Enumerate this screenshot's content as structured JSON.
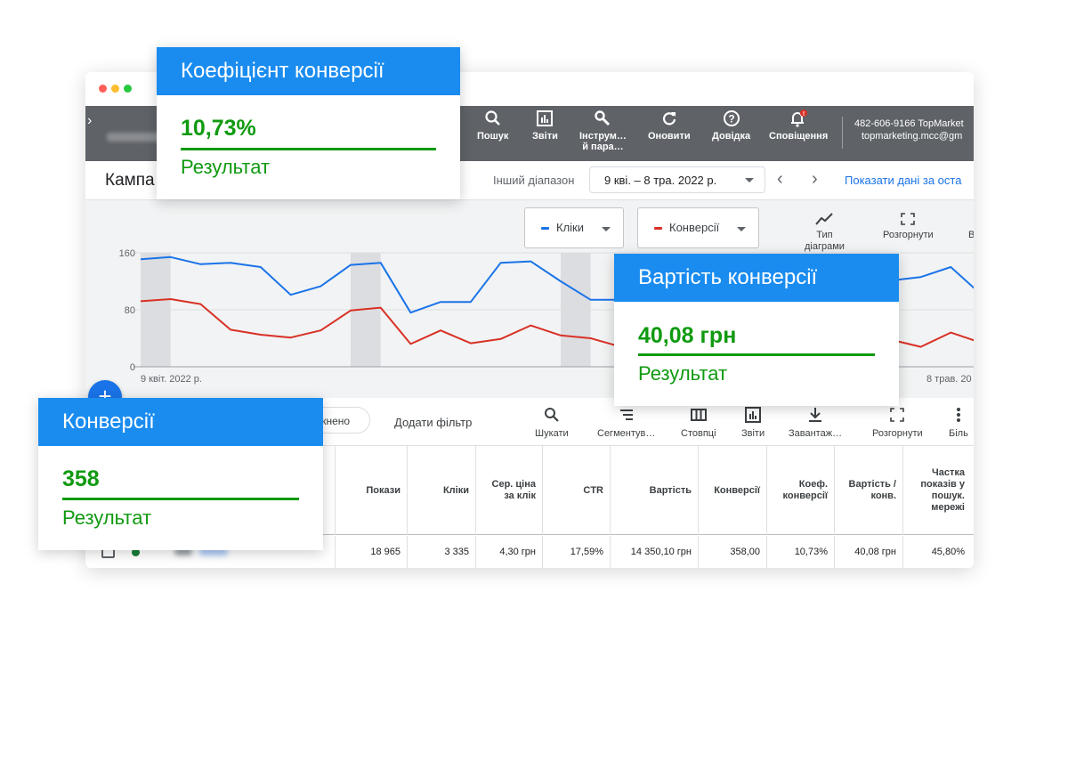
{
  "window": {
    "controls": [
      "close",
      "minimize",
      "maximize"
    ]
  },
  "topbar": {
    "tools": [
      {
        "label": "Пошук",
        "icon": "search-icon"
      },
      {
        "label": "Звіти",
        "icon": "reports-icon"
      },
      {
        "label": "Інструм…",
        "label2": "й пара…",
        "icon": "wrench-icon"
      },
      {
        "label": "Оновити",
        "icon": "refresh-icon"
      },
      {
        "label": "Довідка",
        "icon": "help-icon"
      },
      {
        "label": "Сповіщення",
        "icon": "bell-icon",
        "badge": "!"
      }
    ],
    "account_id": "482-606-9166 TopMarket",
    "account_email": "topmarketing.mcc@gm"
  },
  "subbar": {
    "title": "Кампа",
    "range_label": "Інший діапазон",
    "date_range": "9 кві. – 8 тра. 2022 р.",
    "show_link": "Показати дані за оста"
  },
  "chart": {
    "metric1": "Кліки",
    "metric2": "Конверсії",
    "type_label_1": "Тип",
    "type_label_2": "діаграми",
    "expand_label": "Розгорнути",
    "edge_label": "В",
    "y_ticks": [
      "160",
      "80",
      "0"
    ],
    "x_start": "9 квіт. 2022 р.",
    "x_end": "8 трав. 20"
  },
  "chart_data": {
    "type": "line",
    "ylim": [
      0,
      160
    ],
    "y_ticks": [
      0,
      80,
      160
    ],
    "series": [
      {
        "name": "Кліки",
        "color": "#1a73e8",
        "values": [
          151,
          154,
          144,
          146,
          140,
          101,
          113,
          143,
          146,
          76,
          91,
          91,
          146,
          148,
          120,
          94,
          94,
          104,
          108,
          112,
          106,
          102,
          108,
          113,
          117,
          121,
          126,
          140,
          102
        ]
      },
      {
        "name": "Конверсії",
        "color": "#d93025",
        "values": [
          92,
          95,
          88,
          52,
          45,
          41,
          51,
          79,
          83,
          32,
          51,
          33,
          39,
          58,
          44,
          40,
          28,
          34,
          31,
          34,
          38,
          40,
          42,
          38,
          40,
          38,
          28,
          48,
          34
        ]
      }
    ]
  },
  "tablebar": {
    "pill": "мкнено",
    "add_filter": "Додати фільтр",
    "tools": [
      {
        "label": "Шукати",
        "icon": "search-icon"
      },
      {
        "label": "Сегментув…",
        "icon": "segment-icon"
      },
      {
        "label": "Стовпці",
        "icon": "columns-icon"
      },
      {
        "label": "Звіти",
        "icon": "reports-icon"
      },
      {
        "label": "Завантаж…",
        "icon": "download-icon"
      },
      {
        "label": "Розгорнути",
        "icon": "expand-icon"
      },
      {
        "label": "Біль",
        "icon": "more-icon"
      }
    ]
  },
  "table": {
    "headers": [
      "Покази",
      "Кліки",
      "Сер. ціна за клік",
      "CTR",
      "Вартість",
      "Конверсії",
      "Коеф. конверсії",
      "Вартість / конв.",
      "Частка показів у пошук. мережі"
    ],
    "row": [
      "18 965",
      "3 335",
      "4,30 грн",
      "17,59%",
      "14 350,10 грн",
      "358,00",
      "10,73%",
      "40,08 грн",
      "45,80%"
    ]
  },
  "cards": {
    "conversion_rate": {
      "title": "Коефіцієнт конверсії",
      "value": "10,73%",
      "caption": "Результат"
    },
    "cost_per_conversion": {
      "title": "Вартість конверсії",
      "value": "40,08 грн",
      "caption": "Результат"
    },
    "conversions": {
      "title": "Конверсії",
      "value": "358",
      "caption": "Результат"
    }
  },
  "colors": {
    "accent": "#1a8cf0",
    "result_green": "#109a10",
    "clicks_line": "#1a73e8",
    "conversions_line": "#d93025"
  }
}
